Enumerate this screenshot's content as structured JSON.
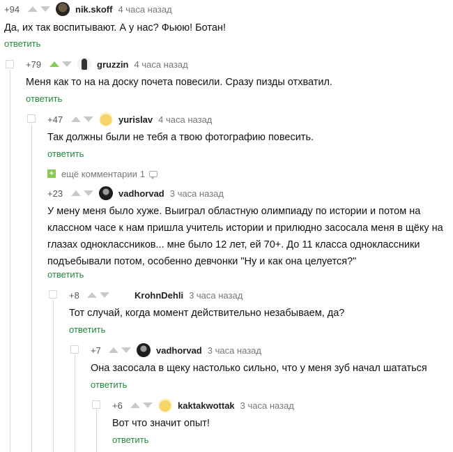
{
  "comments": [
    {
      "score": "+94",
      "nick": "nik.skoff",
      "time": "4 часа назад",
      "text": "Да, их так воспитывают. А у нас? Фьюю! Ботан!",
      "reply": "ответить"
    },
    {
      "score": "+79",
      "nick": "gruzzin",
      "time": "4 часа назад",
      "text": "Меня как то на на доску почета повесили. Сразу пизды отхватил.",
      "reply": "ответить"
    },
    {
      "score": "+47",
      "nick": "yurislav",
      "time": "4 часа назад",
      "text": "Так должны были не тебя а твою фотографию повесить.",
      "reply": "ответить"
    },
    {
      "score": "+23",
      "nick": "vadhorvad",
      "time": "3 часа назад",
      "lines": [
        "У мену меня было хуже. Выиграл областную олимпиаду по истории и потом на",
        "классном часе к нам пришла учитель истории и прилюдно засосала меня в щёку на",
        "глазах одноклассников... мне было 12 лет, ей 70+. До 11 класса одноклассники",
        "подъебывали потом, особенно девчонки \"Ну и как она целуется?\""
      ],
      "reply": "ответить"
    },
    {
      "score": "+8",
      "nick": "KrohnDehli",
      "time": "3 часа назад",
      "text": "Тот случай, когда момент действительно незабываем, да?",
      "reply": "ответить"
    },
    {
      "score": "+7",
      "nick": "vadhorvad",
      "time": "3 часа назад",
      "text": "Она засосала в щеку настолько сильно, что у меня зуб начал шататься",
      "reply": "ответить"
    },
    {
      "score": "+6",
      "nick": "kaktakwottak",
      "time": "3 часа назад",
      "text": "Вот что значит опыт!",
      "reply": "ответить"
    }
  ],
  "more_comments": {
    "label": "ещё комментарии",
    "count": "1"
  }
}
